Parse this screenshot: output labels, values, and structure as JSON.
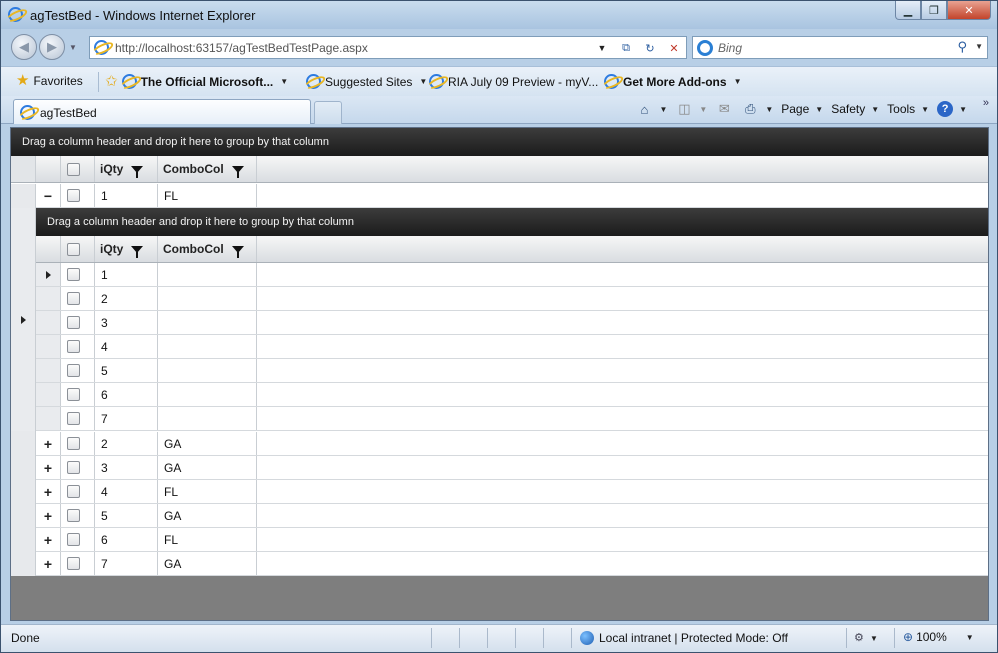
{
  "window": {
    "title": "agTestBed - Windows Internet Explorer"
  },
  "address": {
    "url": "http://localhost:63157/agTestBedTestPage.aspx"
  },
  "search": {
    "placeholder": "Bing"
  },
  "favorites": {
    "favorites_label": "Favorites",
    "items": [
      "The Official Microsoft...",
      "Suggested Sites",
      "RIA July 09 Preview - myV...",
      "Get More Add-ons"
    ]
  },
  "tabs": [
    {
      "label": "agTestBed"
    }
  ],
  "commandbar": {
    "page": "Page",
    "safety": "Safety",
    "tools": "Tools"
  },
  "grid": {
    "group_prompt": "Drag a column header and drop it here to group by that column",
    "columns": [
      "iQty",
      "ComboCol"
    ],
    "expanded_row": {
      "expander": "−",
      "qty": "1",
      "combo": "FL"
    },
    "detail": {
      "group_prompt": "Drag a column header and drop it here to group by that column",
      "columns": [
        "iQty",
        "ComboCol"
      ],
      "rows": [
        {
          "qty": "1",
          "combo": ""
        },
        {
          "qty": "2",
          "combo": ""
        },
        {
          "qty": "3",
          "combo": ""
        },
        {
          "qty": "4",
          "combo": ""
        },
        {
          "qty": "5",
          "combo": ""
        },
        {
          "qty": "6",
          "combo": ""
        },
        {
          "qty": "7",
          "combo": ""
        }
      ]
    },
    "rows": [
      {
        "expander": "+",
        "qty": "2",
        "combo": "GA"
      },
      {
        "expander": "+",
        "qty": "3",
        "combo": "GA"
      },
      {
        "expander": "+",
        "qty": "4",
        "combo": "FL"
      },
      {
        "expander": "+",
        "qty": "5",
        "combo": "GA"
      },
      {
        "expander": "+",
        "qty": "6",
        "combo": "FL"
      },
      {
        "expander": "+",
        "qty": "7",
        "combo": "GA"
      }
    ]
  },
  "status": {
    "text": "Done",
    "zone": "Local intranet | Protected Mode: Off",
    "zoom": "100%"
  }
}
